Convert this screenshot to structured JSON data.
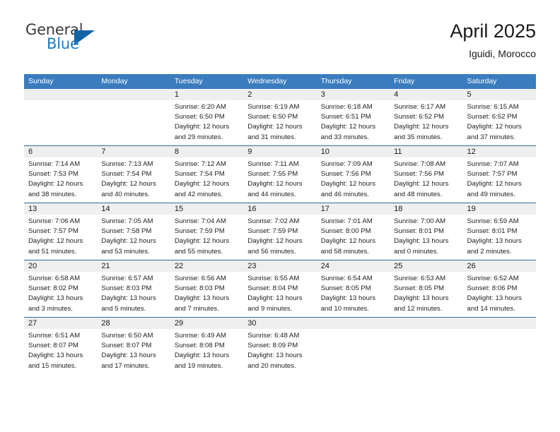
{
  "brand": {
    "name_top": "General",
    "name_bottom": "Blue",
    "triangle_color": "#1464a5",
    "text_color": "#3b3b3b",
    "blue_color": "#1f7ac0"
  },
  "header": {
    "title": "April 2025",
    "subtitle": "Iguidi, Morocco"
  },
  "theme": {
    "header_bg": "#3a7cbe",
    "row_border": "#2b6cad",
    "daynum_bg": "#efefef"
  },
  "weekdays": [
    "Sunday",
    "Monday",
    "Tuesday",
    "Wednesday",
    "Thursday",
    "Friday",
    "Saturday"
  ],
  "labels": {
    "sunrise_prefix": "Sunrise:",
    "sunset_prefix": "Sunset:",
    "daylight_prefix": "Daylight:"
  },
  "weeks": [
    [
      {
        "empty": true
      },
      {
        "empty": true
      },
      {
        "day": "1",
        "sunrise": "Sunrise: 6:20 AM",
        "sunset": "Sunset: 6:50 PM",
        "daylight": "Daylight: 12 hours and 29 minutes."
      },
      {
        "day": "2",
        "sunrise": "Sunrise: 6:19 AM",
        "sunset": "Sunset: 6:50 PM",
        "daylight": "Daylight: 12 hours and 31 minutes."
      },
      {
        "day": "3",
        "sunrise": "Sunrise: 6:18 AM",
        "sunset": "Sunset: 6:51 PM",
        "daylight": "Daylight: 12 hours and 33 minutes."
      },
      {
        "day": "4",
        "sunrise": "Sunrise: 6:17 AM",
        "sunset": "Sunset: 6:52 PM",
        "daylight": "Daylight: 12 hours and 35 minutes."
      },
      {
        "day": "5",
        "sunrise": "Sunrise: 6:15 AM",
        "sunset": "Sunset: 6:52 PM",
        "daylight": "Daylight: 12 hours and 37 minutes."
      }
    ],
    [
      {
        "day": "6",
        "sunrise": "Sunrise: 7:14 AM",
        "sunset": "Sunset: 7:53 PM",
        "daylight": "Daylight: 12 hours and 38 minutes."
      },
      {
        "day": "7",
        "sunrise": "Sunrise: 7:13 AM",
        "sunset": "Sunset: 7:54 PM",
        "daylight": "Daylight: 12 hours and 40 minutes."
      },
      {
        "day": "8",
        "sunrise": "Sunrise: 7:12 AM",
        "sunset": "Sunset: 7:54 PM",
        "daylight": "Daylight: 12 hours and 42 minutes."
      },
      {
        "day": "9",
        "sunrise": "Sunrise: 7:11 AM",
        "sunset": "Sunset: 7:55 PM",
        "daylight": "Daylight: 12 hours and 44 minutes."
      },
      {
        "day": "10",
        "sunrise": "Sunrise: 7:09 AM",
        "sunset": "Sunset: 7:56 PM",
        "daylight": "Daylight: 12 hours and 46 minutes."
      },
      {
        "day": "11",
        "sunrise": "Sunrise: 7:08 AM",
        "sunset": "Sunset: 7:56 PM",
        "daylight": "Daylight: 12 hours and 48 minutes."
      },
      {
        "day": "12",
        "sunrise": "Sunrise: 7:07 AM",
        "sunset": "Sunset: 7:57 PM",
        "daylight": "Daylight: 12 hours and 49 minutes."
      }
    ],
    [
      {
        "day": "13",
        "sunrise": "Sunrise: 7:06 AM",
        "sunset": "Sunset: 7:57 PM",
        "daylight": "Daylight: 12 hours and 51 minutes."
      },
      {
        "day": "14",
        "sunrise": "Sunrise: 7:05 AM",
        "sunset": "Sunset: 7:58 PM",
        "daylight": "Daylight: 12 hours and 53 minutes."
      },
      {
        "day": "15",
        "sunrise": "Sunrise: 7:04 AM",
        "sunset": "Sunset: 7:59 PM",
        "daylight": "Daylight: 12 hours and 55 minutes."
      },
      {
        "day": "16",
        "sunrise": "Sunrise: 7:02 AM",
        "sunset": "Sunset: 7:59 PM",
        "daylight": "Daylight: 12 hours and 56 minutes."
      },
      {
        "day": "17",
        "sunrise": "Sunrise: 7:01 AM",
        "sunset": "Sunset: 8:00 PM",
        "daylight": "Daylight: 12 hours and 58 minutes."
      },
      {
        "day": "18",
        "sunrise": "Sunrise: 7:00 AM",
        "sunset": "Sunset: 8:01 PM",
        "daylight": "Daylight: 13 hours and 0 minutes."
      },
      {
        "day": "19",
        "sunrise": "Sunrise: 6:59 AM",
        "sunset": "Sunset: 8:01 PM",
        "daylight": "Daylight: 13 hours and 2 minutes."
      }
    ],
    [
      {
        "day": "20",
        "sunrise": "Sunrise: 6:58 AM",
        "sunset": "Sunset: 8:02 PM",
        "daylight": "Daylight: 13 hours and 3 minutes."
      },
      {
        "day": "21",
        "sunrise": "Sunrise: 6:57 AM",
        "sunset": "Sunset: 8:03 PM",
        "daylight": "Daylight: 13 hours and 5 minutes."
      },
      {
        "day": "22",
        "sunrise": "Sunrise: 6:56 AM",
        "sunset": "Sunset: 8:03 PM",
        "daylight": "Daylight: 13 hours and 7 minutes."
      },
      {
        "day": "23",
        "sunrise": "Sunrise: 6:55 AM",
        "sunset": "Sunset: 8:04 PM",
        "daylight": "Daylight: 13 hours and 9 minutes."
      },
      {
        "day": "24",
        "sunrise": "Sunrise: 6:54 AM",
        "sunset": "Sunset: 8:05 PM",
        "daylight": "Daylight: 13 hours and 10 minutes."
      },
      {
        "day": "25",
        "sunrise": "Sunrise: 6:53 AM",
        "sunset": "Sunset: 8:05 PM",
        "daylight": "Daylight: 13 hours and 12 minutes."
      },
      {
        "day": "26",
        "sunrise": "Sunrise: 6:52 AM",
        "sunset": "Sunset: 8:06 PM",
        "daylight": "Daylight: 13 hours and 14 minutes."
      }
    ],
    [
      {
        "day": "27",
        "sunrise": "Sunrise: 6:51 AM",
        "sunset": "Sunset: 8:07 PM",
        "daylight": "Daylight: 13 hours and 15 minutes."
      },
      {
        "day": "28",
        "sunrise": "Sunrise: 6:50 AM",
        "sunset": "Sunset: 8:07 PM",
        "daylight": "Daylight: 13 hours and 17 minutes."
      },
      {
        "day": "29",
        "sunrise": "Sunrise: 6:49 AM",
        "sunset": "Sunset: 8:08 PM",
        "daylight": "Daylight: 13 hours and 19 minutes."
      },
      {
        "day": "30",
        "sunrise": "Sunrise: 6:48 AM",
        "sunset": "Sunset: 8:09 PM",
        "daylight": "Daylight: 13 hours and 20 minutes."
      },
      {
        "empty": true
      },
      {
        "empty": true
      },
      {
        "empty": true
      }
    ]
  ]
}
